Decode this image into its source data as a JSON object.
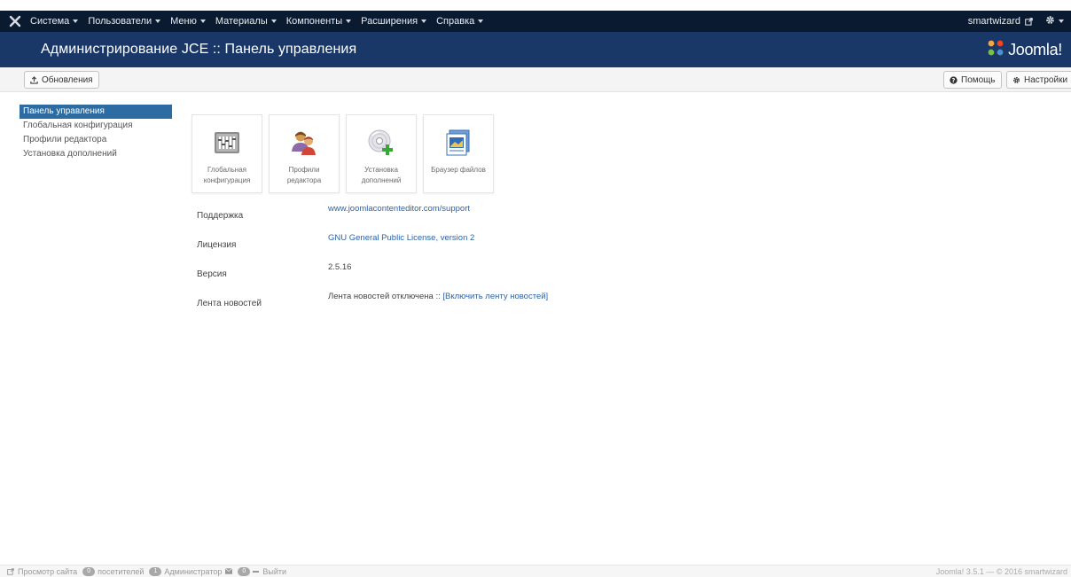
{
  "navbar": {
    "menu": [
      {
        "label": "Система"
      },
      {
        "label": "Пользователи"
      },
      {
        "label": "Меню"
      },
      {
        "label": "Материалы"
      },
      {
        "label": "Компоненты"
      },
      {
        "label": "Расширения"
      },
      {
        "label": "Справка"
      }
    ],
    "user": "smartwizard"
  },
  "header": {
    "title": "Администрирование JCE :: Панель управления",
    "brand": "Joomla!"
  },
  "toolbar": {
    "updates_label": "Обновления",
    "help_label": "Помощь",
    "settings_label": "Настройки"
  },
  "sidebar": {
    "items": [
      {
        "label": "Панель управления",
        "active": true
      },
      {
        "label": "Глобальная конфигурация"
      },
      {
        "label": "Профили редактора"
      },
      {
        "label": "Установка дополнений"
      }
    ]
  },
  "cards": [
    {
      "line1": "Глобальная",
      "line2": "конфигурация",
      "icon": "config-icon"
    },
    {
      "line1": "Профили",
      "line2": "редактора",
      "icon": "users-icon"
    },
    {
      "line1": "Установка",
      "line2": "дополнений",
      "icon": "install-icon"
    },
    {
      "line1": "Браузер файлов",
      "line2": "",
      "icon": "file-browser-icon"
    }
  ],
  "info": {
    "support_label": "Поддержка",
    "support_value": "www.joomlacontenteditor.com/support",
    "license_label": "Лицензия",
    "license_value": "GNU General Public License, version 2",
    "version_label": "Версия",
    "version_value": "2.5.16",
    "news_label": "Лента новостей",
    "news_value": "Лента новостей отключена ::",
    "news_link": "[Включить ленту новостей]"
  },
  "statusbar": {
    "view_site": "Просмотр сайта",
    "visitors_count": "0",
    "visitors_label": "посетителей",
    "admins_count": "1",
    "admins_label": "Администратор",
    "messages_count": "0",
    "logout": "Выйти",
    "copyright": "Joomla! 3.5.1 — © 2016 smartwizard"
  },
  "colors": {
    "navbar": "#0a1b31",
    "header": "#1a3867",
    "sidebar_active": "#2d6ca2",
    "link": "#2c63a8",
    "joomla_logo": [
      "#f9a541",
      "#f44321",
      "#5091cd",
      "#7ac143"
    ]
  }
}
